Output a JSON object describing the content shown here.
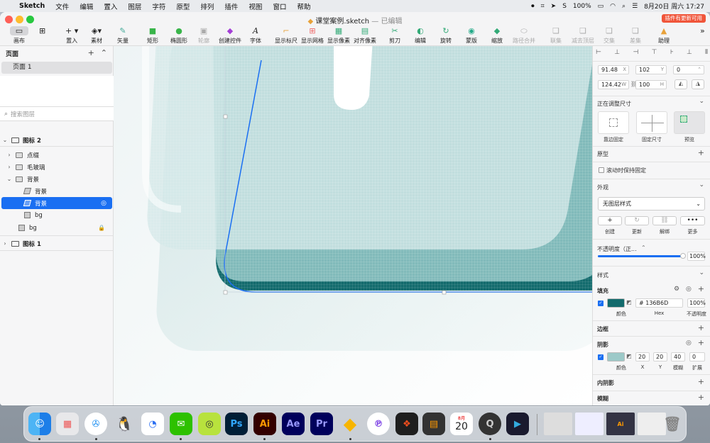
{
  "menubar": {
    "app": "Sketch",
    "items": [
      "文件",
      "编辑",
      "置入",
      "图层",
      "字符",
      "原型",
      "排列",
      "插件",
      "视图",
      "窗口",
      "帮助"
    ],
    "battery": "100%",
    "datetime": "8月20日 周六  17:27"
  },
  "window": {
    "title": "课堂案例.sketch",
    "title_suffix": "— 已编辑",
    "update_badge": "插件有更新可用"
  },
  "toolbar": {
    "canvas": "画布",
    "insert": "置入",
    "assets": "素材",
    "vector": "矢量",
    "rect": "矩形",
    "oval": "椭圆形",
    "outline": "轮廓",
    "component": "创建控件",
    "text": "字体",
    "rulers": "显示标尺",
    "grid": "显示网格",
    "pixels": "显示像素",
    "align_pixels": "对齐像素",
    "scissors": "剪刀",
    "edit": "编辑",
    "rotate": "旋转",
    "mask": "蒙版",
    "scale": "缩放",
    "union_path": "路径合并",
    "union": "联集",
    "subtract": "减去顶层",
    "intersect": "交集",
    "difference": "差集",
    "assistant": "助理"
  },
  "sidebar": {
    "pages_title": "页面",
    "page1": "页面 1",
    "search_placeholder": "搜索图层",
    "layers": {
      "artboard2": "图标 2",
      "dots": "点缀",
      "glass": "毛玻璃",
      "bg_group": "背景",
      "bg_layer1": "背景",
      "bg_layer2": "背景",
      "bg_small": "bg",
      "bg_locked": "bg",
      "artboard1": "图标 1"
    }
  },
  "inspector": {
    "x": "91.48",
    "x_u": "X",
    "y": "102",
    "y_u": "Y",
    "rot": "0",
    "w": "124.42",
    "w_u": "W",
    "h": "100",
    "h_u": "H",
    "resizing": "正在调整尺寸",
    "pin": "靠边固定",
    "fixed": "固定尺寸",
    "preview": "预览",
    "prototype": "原型",
    "fix_scroll": "滚动时保持固定",
    "appearance": "外观",
    "layer_style": "无图层样式",
    "create": "创建",
    "update": "更新",
    "detach": "解绑",
    "more": "更多",
    "opacity_label": "不透明度（正...",
    "opacity": "100%",
    "style": "样式",
    "fill": "填充",
    "fill_hex": "# 136B6D",
    "fill_opacity": "100%",
    "color_label": "颜色",
    "hex_label": "Hex",
    "opacity_small": "不透明度",
    "border": "边框",
    "shadow": "阴影",
    "sh_x": "20",
    "sh_y": "20",
    "sh_blur": "40",
    "sh_spread": "0",
    "x_lbl": "X",
    "y_lbl": "Y",
    "blur_lbl": "模糊",
    "spread_lbl": "扩展",
    "inner_shadow": "内阴影",
    "blur": "模糊",
    "fill_color": "#136B6D"
  },
  "dock": {
    "ps": "Ps",
    "ai": "Ai",
    "ae": "Ae",
    "pr": "Pr",
    "cal_month": "8月",
    "cal_day": "20"
  }
}
